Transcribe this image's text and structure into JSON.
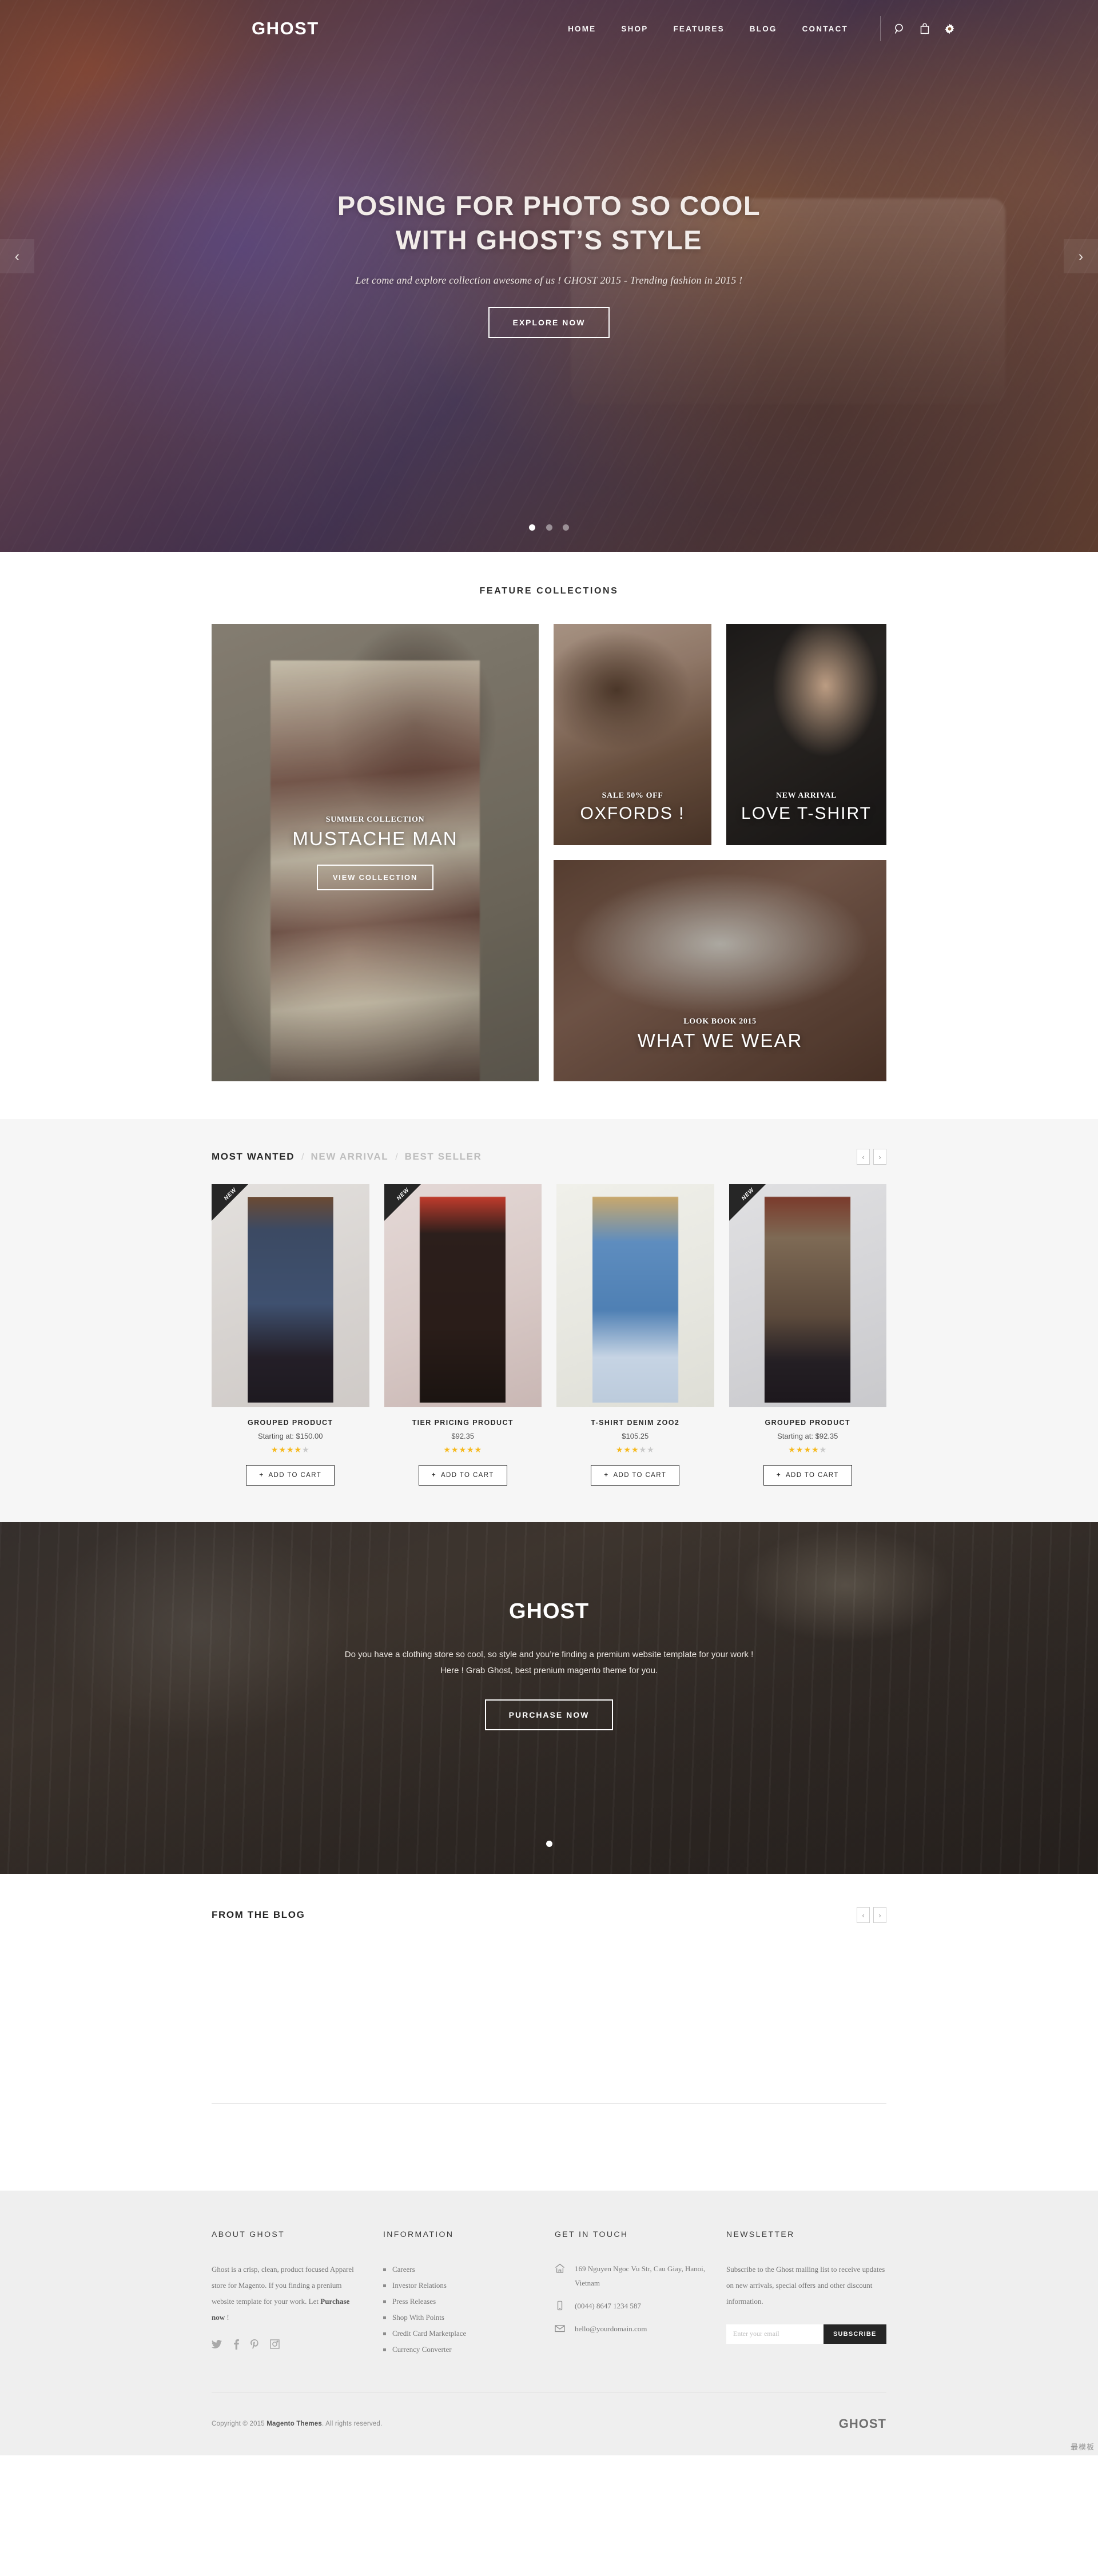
{
  "header": {
    "logo": "GHOST",
    "nav": [
      {
        "label": "HOME"
      },
      {
        "label": "SHOP"
      },
      {
        "label": "FEATURES"
      },
      {
        "label": "BLOG"
      },
      {
        "label": "CONTACT"
      }
    ],
    "icons": [
      "search-icon",
      "cart-icon",
      "settings-icon"
    ]
  },
  "hero": {
    "title_line1": "POSING FOR PHOTO SO COOL",
    "title_line2": "WITH GHOST’S STYLE",
    "subtitle": "Let come and explore collection awesome of us ! GHOST 2015 - Trending fashion in 2015 !",
    "cta": "EXPLORE NOW",
    "prev": "‹",
    "next": "›",
    "dots": 3,
    "active_dot": 0
  },
  "features": {
    "title": "FEATURE COLLECTIONS",
    "main": {
      "kicker": "SUMMER COLLECTION",
      "title": "MUSTACHE MAN",
      "button": "VIEW COLLECTION"
    },
    "cards": [
      {
        "kicker": "SALE 50% OFF",
        "title": "OXFORDS !"
      },
      {
        "kicker": "NEW ARRIVAL",
        "title": "LOVE T-SHIRT"
      }
    ],
    "wide": {
      "kicker": "LOOK BOOK 2015",
      "title": "WHAT WE WEAR"
    }
  },
  "most_wanted": {
    "tabs": [
      {
        "label": "MOST WANTED",
        "active": true
      },
      {
        "label": "NEW ARRIVAL",
        "active": false
      },
      {
        "label": "BEST SELLER",
        "active": false
      }
    ],
    "separator": "/",
    "prev": "‹",
    "next": "›",
    "products": [
      {
        "badge": "NEW",
        "name": "GROUPED PRODUCT",
        "price": "Starting at: $150.00",
        "rating": 4,
        "cart": "ADD TO CART"
      },
      {
        "badge": "NEW",
        "name": "TIER PRICING PRODUCT",
        "price": "$92.35",
        "rating": 5,
        "cart": "ADD TO CART"
      },
      {
        "badge": "",
        "name": "T-SHIRT DENIM ZOO2",
        "price": "$105.25",
        "rating": 3,
        "cart": "ADD TO CART"
      },
      {
        "badge": "NEW",
        "name": "GROUPED PRODUCT",
        "price": "Starting at: $92.35",
        "rating": 4,
        "cart": "ADD TO CART"
      }
    ]
  },
  "promo": {
    "title": "GHOST",
    "line1": "Do you have a clothing store so cool, so style and you’re finding a premium website template for your work !",
    "line2": "Here ! Grab Ghost, best prenium magento theme for you.",
    "cta": "PURCHASE NOW",
    "dots": 1,
    "active_dot": 0
  },
  "blog": {
    "title": "FROM THE BLOG",
    "prev": "‹",
    "next": "›"
  },
  "footer": {
    "about": {
      "heading": "ABOUT GHOST",
      "text_before": "Ghost is a crisp, clean, product focused Apparel store for Magento. If you finding a prenium website template for your work. Let ",
      "text_bold": "Purchase now",
      "text_after": " !",
      "socials": [
        "twitter-icon",
        "facebook-icon",
        "pinterest-icon",
        "instagram-icon"
      ]
    },
    "information": {
      "heading": "INFORMATION",
      "items": [
        "Careers",
        "Investor Relations",
        "Press Releases",
        "Shop With Points",
        "Credit Card Marketplace",
        "Currency Converter"
      ]
    },
    "contact": {
      "heading": "GET IN TOUCH",
      "address": "169 Nguyen Ngoc Vu Str, Cau Giay, Hanoi, Vietnam",
      "phone": "(0044) 8647 1234 587",
      "email": "hello@yourdomain.com"
    },
    "newsletter": {
      "heading": "NEWSLETTER",
      "text": "Subscribe to the Ghost mailing list to receive updates on new arrivals, special offers and other discount information.",
      "placeholder": "Enter your email",
      "value": "",
      "button": "SUBSCRIBE"
    },
    "copyright_pre": "Copyright © 2015 ",
    "copyright_brand": "Magento Themes",
    "copyright_post": ". All rights reserved.",
    "logo": "GHOST"
  },
  "watermark": "最模板"
}
